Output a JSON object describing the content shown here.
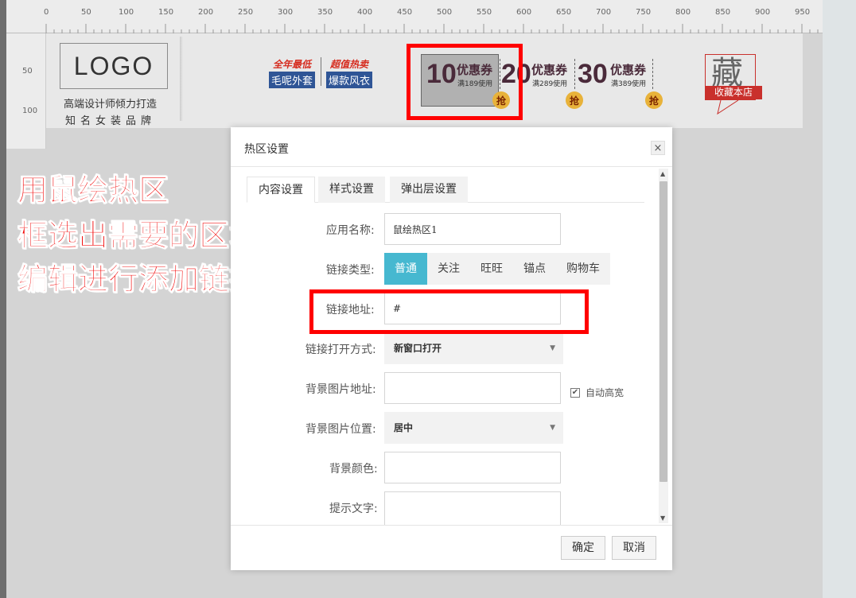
{
  "ruler": {
    "h_ticks": [
      "0",
      "50",
      "100",
      "150",
      "200",
      "250",
      "300",
      "350",
      "400",
      "450",
      "500",
      "550",
      "600",
      "650",
      "700",
      "750",
      "800",
      "850",
      "900",
      "950"
    ],
    "v_ticks": [
      "50",
      "100"
    ]
  },
  "banner": {
    "logo": "LOGO",
    "logo_sub1": "高端设计师倾力打造",
    "logo_sub2": "知名女装品牌",
    "promos": [
      {
        "top": "全年最低",
        "bottom": "毛呢外套"
      },
      {
        "top": "超值热卖",
        "bottom": "爆款风衣"
      }
    ],
    "coupons": [
      {
        "amount": "10",
        "title": "优惠券",
        "condition": "满189使用",
        "grab": "抢"
      },
      {
        "amount": "20",
        "title": "优惠券",
        "condition": "满289使用",
        "grab": "抢"
      },
      {
        "amount": "30",
        "title": "优惠券",
        "condition": "满389使用",
        "grab": "抢"
      }
    ],
    "favorite": {
      "char": "藏",
      "label": "收藏本店"
    }
  },
  "annotation": {
    "lines": [
      "用鼠绘热区",
      "框选出需要的区域",
      "编辑进行添加链接"
    ]
  },
  "dialog": {
    "title": "热区设置",
    "close": "×",
    "tabs": [
      {
        "label": "内容设置",
        "active": true
      },
      {
        "label": "样式设置",
        "active": false
      },
      {
        "label": "弹出层设置",
        "active": false
      }
    ],
    "fields": {
      "app_name_label": "应用名称:",
      "app_name_value": "鼠绘热区1",
      "link_type_label": "链接类型:",
      "link_types": [
        {
          "label": "普通",
          "active": true
        },
        {
          "label": "关注",
          "active": false
        },
        {
          "label": "旺旺",
          "active": false
        },
        {
          "label": "锚点",
          "active": false
        },
        {
          "label": "购物车",
          "active": false
        }
      ],
      "link_url_label": "链接地址:",
      "link_url_value": "#",
      "open_mode_label": "链接打开方式:",
      "open_mode_value": "新窗口打开",
      "bg_image_label": "背景图片地址:",
      "bg_image_value": "",
      "auto_size_label": "自动高宽",
      "auto_size_checked": true,
      "bg_position_label": "背景图片位置:",
      "bg_position_value": "居中",
      "bg_color_label": "背景颜色:",
      "bg_color_value": "",
      "tooltip_label": "提示文字:",
      "tooltip_value": ""
    },
    "buttons": {
      "confirm": "确定",
      "cancel": "取消"
    }
  },
  "colors": {
    "highlight_red": "#ff0000",
    "active_tab_blue": "#46b8d0",
    "promo_blue": "#2f5596",
    "coupon_badge": "#e8b23a"
  }
}
